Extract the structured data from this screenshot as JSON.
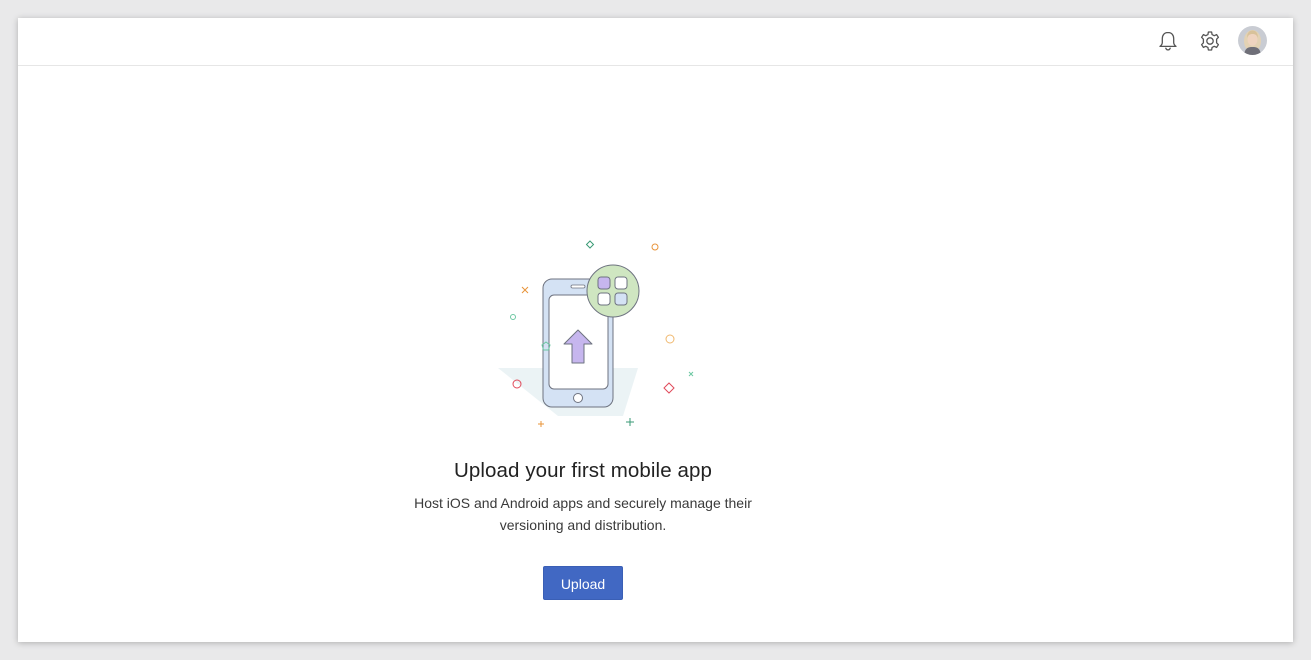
{
  "header": {
    "icons": [
      "bell-icon",
      "gear-icon"
    ],
    "avatar": "user-avatar"
  },
  "empty_state": {
    "title": "Upload your first mobile app",
    "description": "Host iOS and Android apps and securely manage their versioning and distribution.",
    "button_label": "Upload"
  },
  "colors": {
    "accent": "#4168c3",
    "phone_fill": "#d4e2f4",
    "arrow_fill": "#c6b6ee",
    "badge_fill": "#cfe6c1"
  }
}
